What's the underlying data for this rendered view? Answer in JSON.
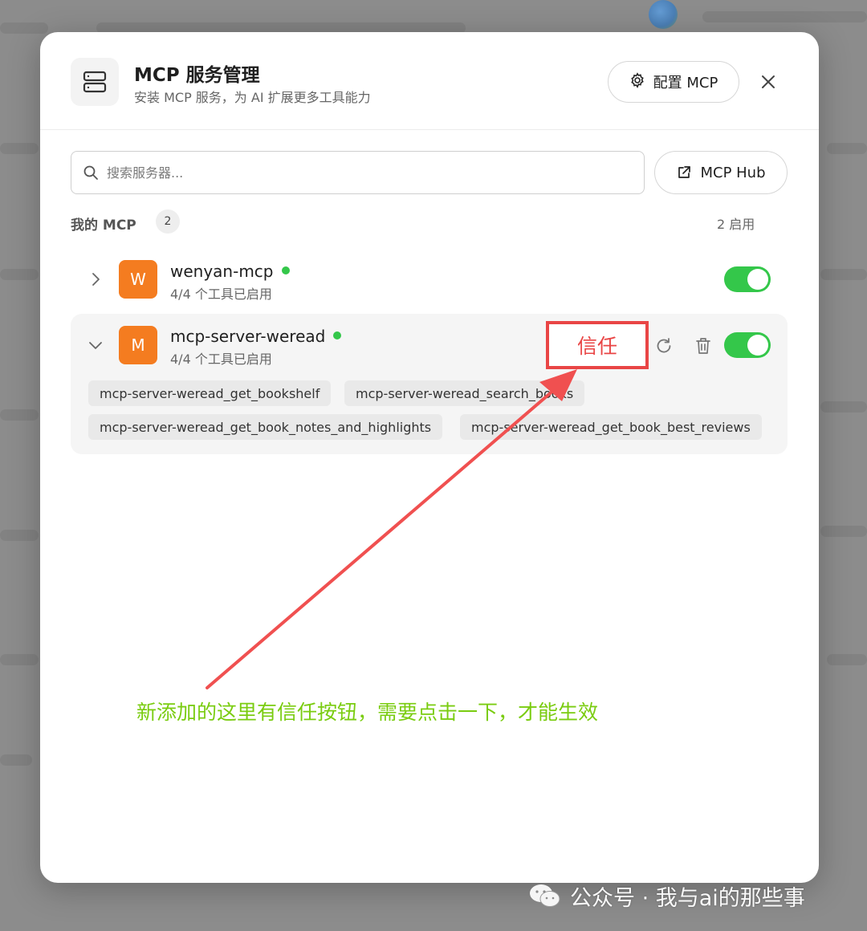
{
  "modal": {
    "title": "MCP 服务管理",
    "subtitle": "安装 MCP 服务，为 AI 扩展更多工具能力",
    "config_label": "配置 MCP",
    "hub_label": "MCP Hub",
    "search_placeholder": "搜索服务器..."
  },
  "section": {
    "label": "我的 MCP",
    "count": "2",
    "enabled": "2 启用"
  },
  "servers": [
    {
      "avatar": "W",
      "name": "wenyan-mcp",
      "tools_status": "4/4 个工具已启用",
      "enabled": true,
      "expanded": false
    },
    {
      "avatar": "M",
      "name": "mcp-server-weread",
      "tools_status": "4/4 个工具已启用",
      "enabled": true,
      "expanded": true,
      "trust_label": "信任",
      "tools": [
        "mcp-server-weread_get_bookshelf",
        "mcp-server-weread_search_books",
        "mcp-server-weread_get_book_notes_and_highlights",
        "mcp-server-weread_get_book_best_reviews"
      ]
    }
  ],
  "annotation": {
    "text": "新添加的这里有信任按钮，需要点击一下，才能生效",
    "color": "#7acc10",
    "arrow_color": "#f05050"
  },
  "watermark": {
    "text": "公众号 · 我与ai的那些事"
  },
  "colors": {
    "accent_green": "#34c74a",
    "avatar_orange": "#f47c20",
    "highlight_red": "#e94545"
  }
}
